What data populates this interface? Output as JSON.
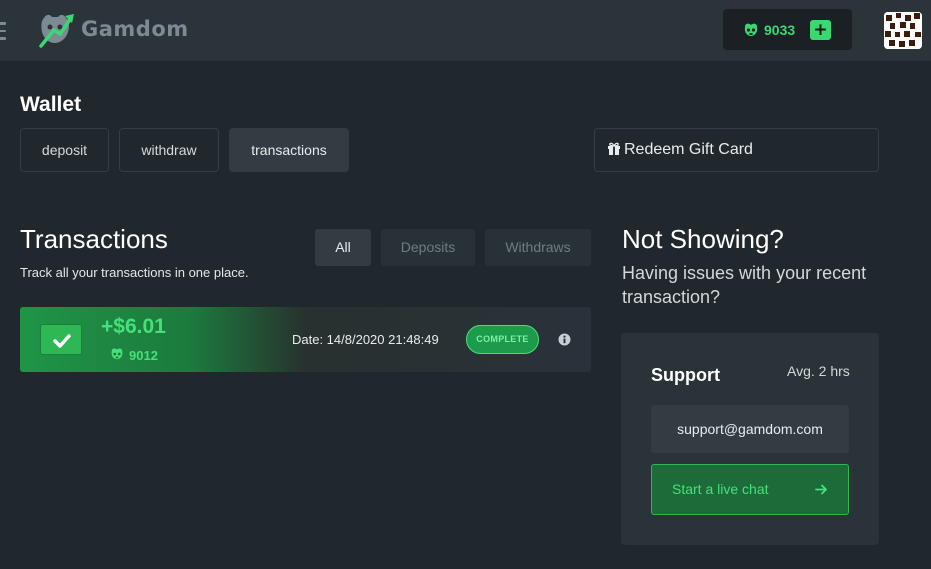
{
  "header": {
    "brand": "Gamdom",
    "balance": "9033",
    "add_label": "+"
  },
  "wallet": {
    "title": "Wallet",
    "tabs": [
      {
        "label": "deposit",
        "active": false
      },
      {
        "label": "withdraw",
        "active": false
      },
      {
        "label": "transactions",
        "active": true
      }
    ],
    "redeem_label": "Redeem Gift Card"
  },
  "transactions": {
    "title": "Transactions",
    "subtitle": "Track all your transactions in one place.",
    "filters": [
      {
        "label": "All",
        "active": true
      },
      {
        "label": "Deposits",
        "active": false
      },
      {
        "label": "Withdraws",
        "active": false
      }
    ],
    "items": [
      {
        "amount": "+$6.01",
        "coins": "9012",
        "date": "Date: 14/8/2020 21:48:49",
        "status": "COMPLETE"
      }
    ]
  },
  "help": {
    "title": "Not Showing?",
    "subtitle": "Having issues with your recent transaction?",
    "support_title": "Support",
    "support_time": "Avg. 2 hrs",
    "email": "support@gamdom.com",
    "chat_label": "Start a live chat"
  },
  "colors": {
    "background": "#21282d",
    "topbar": "#2b3439",
    "accent_green": "#3bd872",
    "panel": "#2a3338"
  },
  "icons": [
    "menu-icon",
    "gamdom-logo-icon",
    "coin-icon",
    "plus-icon",
    "gift-icon",
    "check-icon",
    "info-icon",
    "arrow-right-icon"
  ]
}
